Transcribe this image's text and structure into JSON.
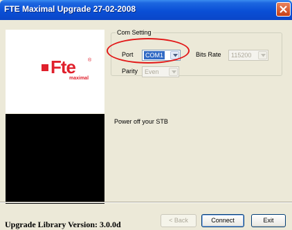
{
  "window": {
    "title": "FTE Maximal Upgrade    27-02-2008",
    "close_icon": "close-icon"
  },
  "logo": {
    "brand": "Fte",
    "sub": "maximal",
    "reg": "®",
    "color": "#e0202c"
  },
  "com_setting": {
    "legend": "Com Setting",
    "port_label": "Port",
    "port_value": "COM1",
    "bits_rate_label": "Bits Rate",
    "bits_rate_value": "115200",
    "parity_label": "Parity",
    "parity_value": "Even"
  },
  "status": {
    "message": "Power off your STB"
  },
  "buttons": {
    "back": "< Back",
    "connect": "Connect",
    "exit": "Exit"
  },
  "footer": {
    "version": "Upgrade Library Version: 3.0.0d"
  },
  "colors": {
    "titlebar": "#0a4fd6",
    "highlight_circle": "#e21818",
    "selection": "#316ac5"
  }
}
